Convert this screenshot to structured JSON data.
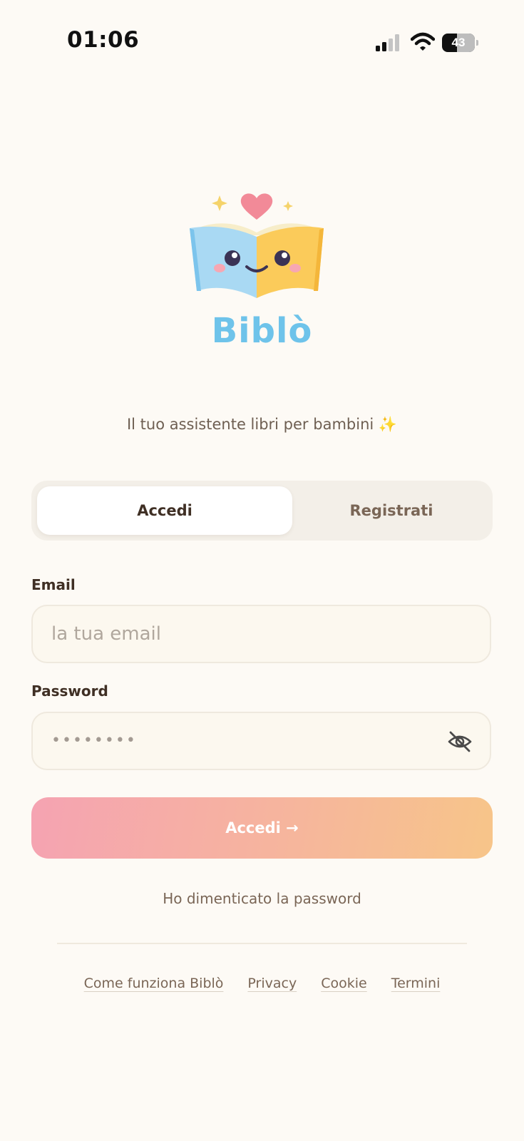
{
  "status_bar": {
    "time": "01:06",
    "battery_level": "43",
    "icons": [
      "signal-icon",
      "wifi-icon",
      "battery-icon"
    ]
  },
  "brand": {
    "name": "Biblò",
    "tagline": "Il tuo assistente libri per bambini ✨",
    "logo_icon": "happy-book-icon"
  },
  "tabs": {
    "login_label": "Accedi",
    "register_label": "Registrati",
    "active": "login"
  },
  "form": {
    "email_label": "Email",
    "email_placeholder": "la tua email",
    "email_value": "",
    "password_label": "Password",
    "password_masked": "••••••••",
    "password_toggle_icon": "eye-off-icon",
    "submit_label": "Accedi →"
  },
  "forgot_password": "Ho dimenticato la password",
  "footer": {
    "links": [
      "Come funziona Biblò",
      "Privacy",
      "Cookie",
      "Termini"
    ]
  },
  "colors": {
    "background": "#fdfaf5",
    "brand_blue": "#6ec3ea",
    "button_gradient_start": "#f5a3b2",
    "button_gradient_end": "#f7c589",
    "text_brown": "#4a3a2e"
  }
}
